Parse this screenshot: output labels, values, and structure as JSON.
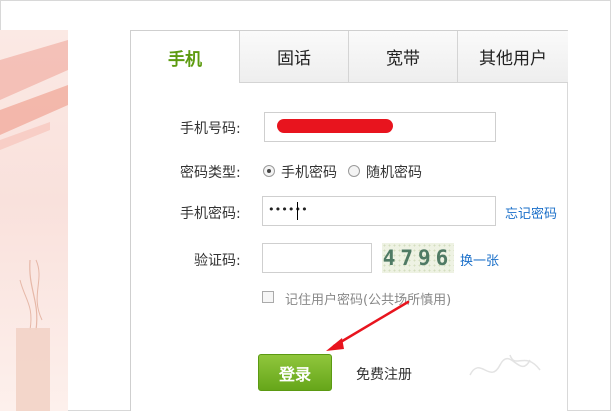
{
  "tabs": [
    {
      "label": "手机",
      "active": true
    },
    {
      "label": "固话",
      "active": false
    },
    {
      "label": "宽带",
      "active": false
    },
    {
      "label": "其他用户",
      "active": false
    }
  ],
  "form": {
    "phone_label": "手机号码:",
    "pw_type_label": "密码类型:",
    "pw_type_options": [
      {
        "label": "手机密码",
        "selected": true
      },
      {
        "label": "随机密码",
        "selected": false
      }
    ],
    "pw_label": "手机密码:",
    "pw_value": "••••••",
    "forgot_pw": "忘记密码",
    "captcha_label": "验证码:",
    "captcha_value": "",
    "captcha_image_text": "4796",
    "refresh_captcha": "换一张",
    "remember_label": "记住用户密码(公共场所慎用)",
    "remember_checked": false,
    "login_button": "登录",
    "register_link": "免费注册"
  },
  "colors": {
    "accent_green": "#5d9b10",
    "link_blue": "#1a6fc9",
    "annotation_red": "#e8141e"
  },
  "annotations": {
    "phone_redaction": "red-scribble",
    "arrow": "red-arrow-to-login-button"
  }
}
